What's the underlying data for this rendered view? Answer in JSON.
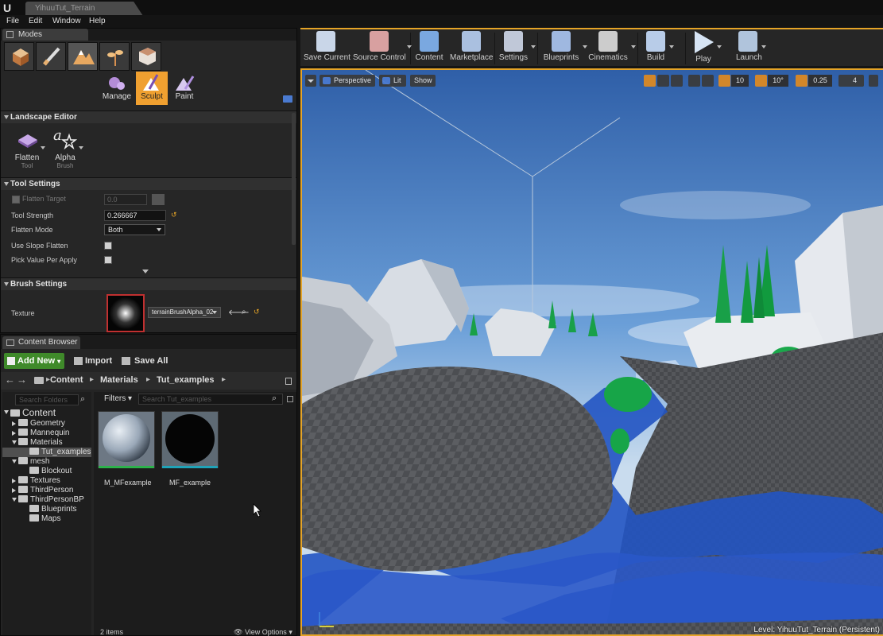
{
  "window": {
    "tab_title": "YihuuTut_Terrain"
  },
  "menu": [
    "File",
    "Edit",
    "Window",
    "Help"
  ],
  "modes_panel": {
    "tab_label": "Modes",
    "sub_modes": [
      "Manage",
      "Sculpt",
      "Paint"
    ],
    "active_sub_mode": "Sculpt",
    "landscape_editor": {
      "title": "Landscape Editor",
      "tools": [
        {
          "label": "Flatten",
          "sub": "Tool"
        },
        {
          "label": "Alpha",
          "sub": "Brush"
        }
      ]
    },
    "tool_settings": {
      "title": "Tool Settings",
      "flatten_target_label": "Flatten Target",
      "flatten_target_value": "0.0",
      "tool_strength_label": "Tool Strength",
      "tool_strength_value": "0.266667",
      "flatten_mode_label": "Flatten Mode",
      "flatten_mode_value": "Both",
      "use_slope_flatten_label": "Use Slope Flatten",
      "pick_value_label": "Pick Value Per Apply"
    },
    "brush_settings": {
      "title": "Brush Settings",
      "texture_label": "Texture",
      "texture_value": "terrainBrushAlpha_02"
    }
  },
  "content_browser": {
    "tab_label": "Content Browser",
    "add_new_label": "Add New",
    "import_label": "Import",
    "save_all_label": "Save All",
    "path": [
      "Content",
      "Materials",
      "Tut_examples"
    ],
    "search_folders_placeholder": "Search Folders",
    "filters_label": "Filters",
    "search_assets_placeholder": "Search Tut_examples",
    "tree": [
      {
        "label": "Content",
        "level": 0,
        "expanded": true
      },
      {
        "label": "Geometry",
        "level": 1,
        "expanded": false
      },
      {
        "label": "Mannequin",
        "level": 1,
        "expanded": false
      },
      {
        "label": "Materials",
        "level": 1,
        "expanded": true
      },
      {
        "label": "Tut_examples",
        "level": 2,
        "selected": true
      },
      {
        "label": "mesh",
        "level": 1,
        "expanded": true
      },
      {
        "label": "Blockout",
        "level": 2
      },
      {
        "label": "Textures",
        "level": 1,
        "expanded": false
      },
      {
        "label": "ThirdPerson",
        "level": 1,
        "expanded": false
      },
      {
        "label": "ThirdPersonBP",
        "level": 1,
        "expanded": true
      },
      {
        "label": "Blueprints",
        "level": 2
      },
      {
        "label": "Maps",
        "level": 2
      }
    ],
    "assets": [
      {
        "name": "M_MFexample",
        "type": "material",
        "color": "#2db24b"
      },
      {
        "name": "MF_example",
        "type": "material-function",
        "color": "#1fa3b8"
      }
    ],
    "item_count": "2 items",
    "view_options_label": "View Options"
  },
  "toolbar": [
    {
      "label": "Save Current",
      "icon": "save-icon"
    },
    {
      "label": "Source Control",
      "icon": "source-control-icon"
    },
    {
      "label": "Content",
      "icon": "content-icon"
    },
    {
      "label": "Marketplace",
      "icon": "marketplace-icon"
    },
    {
      "label": "Settings",
      "icon": "settings-icon"
    },
    {
      "label": "Blueprints",
      "icon": "blueprints-icon"
    },
    {
      "label": "Cinematics",
      "icon": "cinematics-icon"
    },
    {
      "label": "Build",
      "icon": "build-icon"
    },
    {
      "label": "Play",
      "icon": "play-icon"
    },
    {
      "label": "Launch",
      "icon": "launch-icon"
    }
  ],
  "viewport": {
    "view_mode": "Perspective",
    "lighting": "Lit",
    "show_label": "Show",
    "grid_snap": "10",
    "rotation_snap": "10°",
    "scale_snap": "0.25",
    "camera_speed": "4",
    "level_label": "Level:  YihuuTut_Terrain (Persistent)"
  },
  "colors": {
    "accent_orange": "#e5a427",
    "add_new_green": "#3f8a2a",
    "sculpt_active": "#f0a030"
  }
}
